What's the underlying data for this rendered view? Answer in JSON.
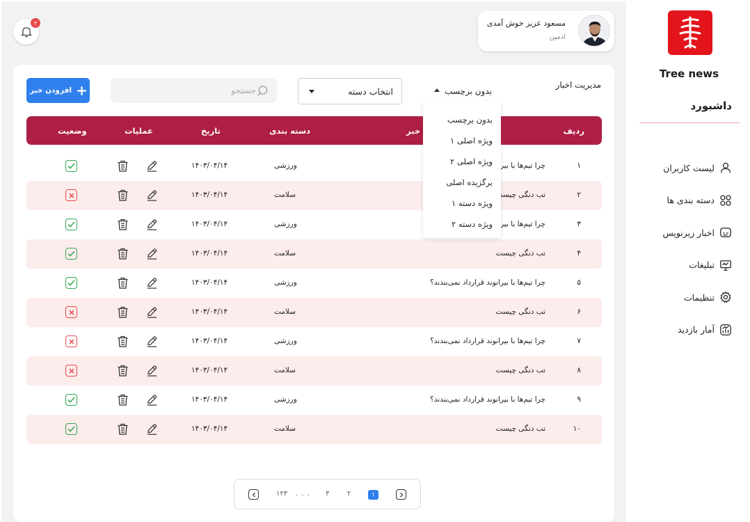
{
  "sidebar": {
    "brand": "Tree news",
    "dashboard": "داشبورد",
    "items": [
      {
        "label": "لیست کاربران",
        "icon": "user-icon"
      },
      {
        "label": "دسته بندی ها",
        "icon": "grid-icon"
      },
      {
        "label": "اخبار زیرنویس",
        "icon": "subtitle-icon"
      },
      {
        "label": "تبلیغات",
        "icon": "presentation-icon"
      },
      {
        "label": "تنظیمات",
        "icon": "gear-icon"
      },
      {
        "label": "آمار بازدید",
        "icon": "stats-icon"
      }
    ]
  },
  "topbar": {
    "notification_count": "۳",
    "profile_name": "مسعود عزیز خوش آمدی",
    "profile_role": "ادمین"
  },
  "card": {
    "title": "مدیریت اخبار",
    "tag_select": "بدون برچسب",
    "category_select": "انتخاب دسته",
    "search_placeholder": "جستجو",
    "add_button": "افزودن خبر"
  },
  "table": {
    "headers": {
      "index": "ردیف",
      "title": "عنوان خبر",
      "category": "دسته بندی",
      "date": "تاریخ",
      "operations": "عملیات",
      "status": "وضعیت"
    },
    "rows": [
      {
        "index": "۱",
        "title": "چرا تیم‌ها با بیرانوند قرارداد نمی‌بندند؟",
        "category": "ورزشی",
        "date": "۱۴۰۳/۰۴/۱۴",
        "status": "active"
      },
      {
        "index": "۲",
        "title": "تب دنگی چیست",
        "category": "سلامت",
        "date": "۱۴۰۳/۰۴/۱۴",
        "status": "inactive"
      },
      {
        "index": "۳",
        "title": "چرا تیم‌ها با بیرانوند قرارداد نمی‌بندند؟",
        "category": "ورزشی",
        "date": "۱۴۰۳/۰۴/۱۴",
        "status": "active"
      },
      {
        "index": "۴",
        "title": "تب دنگی چیست",
        "category": "سلامت",
        "date": "۱۴۰۳/۰۴/۱۴",
        "status": "active"
      },
      {
        "index": "۵",
        "title": "چرا تیم‌ها با بیرانوند قرارداد نمی‌بندند؟",
        "category": "ورزشی",
        "date": "۱۴۰۳/۰۴/۱۴",
        "status": "active"
      },
      {
        "index": "۶",
        "title": "تب دنگی چیست",
        "category": "سلامت",
        "date": "۱۴۰۳/۰۴/۱۴",
        "status": "inactive"
      },
      {
        "index": "۷",
        "title": "چرا تیم‌ها با بیرانوند قرارداد نمی‌بندند؟",
        "category": "ورزشی",
        "date": "۱۴۰۳/۰۴/۱۴",
        "status": "inactive"
      },
      {
        "index": "۸",
        "title": "تب دنگی چیست",
        "category": "سلامت",
        "date": "۱۴۰۳/۰۴/۱۴",
        "status": "inactive"
      },
      {
        "index": "۹",
        "title": "چرا تیم‌ها با بیرانوند قرارداد نمی‌بندند؟",
        "category": "ورزشی",
        "date": "۱۴۰۳/۰۴/۱۴",
        "status": "active"
      },
      {
        "index": "۱۰",
        "title": "تب دنگی چیست",
        "category": "سلامت",
        "date": "۱۴۰۳/۰۴/۱۴",
        "status": "active"
      }
    ]
  },
  "tag_dropdown": {
    "options": [
      "بدون برچسب",
      "ویژه اصلی ۱",
      "ویژه اصلی ۲",
      "برگزیده اصلی",
      "ویژه دسته ۱",
      "ویژه دسته ۲"
    ]
  },
  "pagination": {
    "pages": [
      "۱",
      "۲",
      "۳",
      ". . .",
      "۱۲۳"
    ],
    "current": "۱"
  },
  "colors": {
    "brand_red": "#e3141b",
    "header_red": "#ae1f45",
    "row_alt": "#fcecec",
    "primary_blue": "#2f80ed",
    "status_ok": "#32a852",
    "status_bad": "#e84a4a"
  }
}
